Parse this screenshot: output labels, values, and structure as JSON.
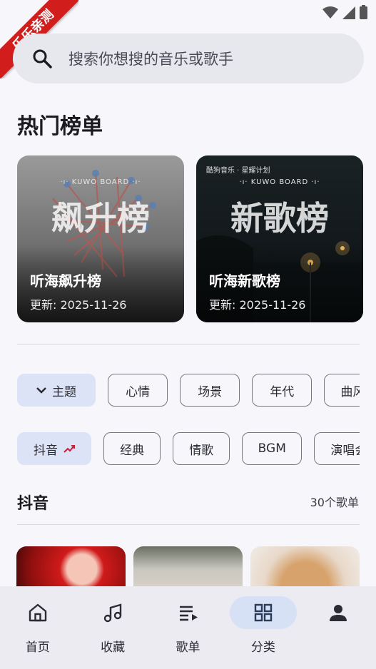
{
  "watermark": "乐乐亲测",
  "search": {
    "placeholder": "搜索你想搜的音乐或歌手"
  },
  "hot_section": {
    "title": "热门榜单",
    "cards": [
      {
        "logo": "·ı· KUWO BOARD ·ı·",
        "art_title": "飙升榜",
        "name": "听海飙升榜",
        "updated": "更新: 2025-11-26"
      },
      {
        "brand": "酷狗音乐 · 星耀计划",
        "logo": "·ı· KUWO BOARD ·ı·",
        "art_title": "新歌榜",
        "name": "听海新歌榜",
        "updated": "更新: 2025-11-26"
      }
    ]
  },
  "category_chips": [
    "主题",
    "心情",
    "场景",
    "年代",
    "曲风流"
  ],
  "tag_chips": [
    "抖音",
    "经典",
    "情歌",
    "BGM",
    "演唱会"
  ],
  "playlist_section": {
    "title": "抖音",
    "count": "30个歌单"
  },
  "nav": [
    {
      "label": "首页",
      "icon": "home-icon"
    },
    {
      "label": "收藏",
      "icon": "music-note-icon"
    },
    {
      "label": "歌单",
      "icon": "playlist-icon"
    },
    {
      "label": "分类",
      "icon": "grid-icon"
    },
    {
      "label": "",
      "icon": "profile-icon"
    }
  ],
  "colors": {
    "accent": "#dce3f7",
    "ribbon": "#d21d1d",
    "nav_bg": "#ecebf2"
  }
}
